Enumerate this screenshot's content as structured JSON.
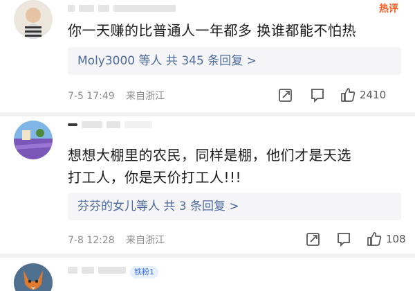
{
  "comments": [
    {
      "username": "",
      "hot_label": "热评",
      "badge": "",
      "content": "你一天赚的比普通人一年都多 换谁都能不怕热",
      "replies": "Moly3000 等人 共 345 条回复 >",
      "date": "7-5 17:49",
      "location": "来自浙江",
      "likes": "2410"
    },
    {
      "username": "",
      "hot_label": "",
      "badge": "",
      "content": "想想大棚里的农民，同样是棚，他们才是天选打工人，你是天价打工人!!!",
      "replies": "芬芬的女儿等人 共 3 条回复 >",
      "date": "7-8 12:28",
      "location": "来自浙江",
      "likes": "108"
    },
    {
      "username": "",
      "hot_label": "",
      "badge": "铁粉1",
      "content": "",
      "replies": "",
      "date": "",
      "location": "",
      "likes": ""
    }
  ],
  "icons": [
    "share-icon",
    "comment-icon",
    "like-icon"
  ],
  "colors": {
    "hot": "#ff5a1f",
    "link": "#4d6a9c",
    "reply_bg": "#f5f5f7"
  }
}
